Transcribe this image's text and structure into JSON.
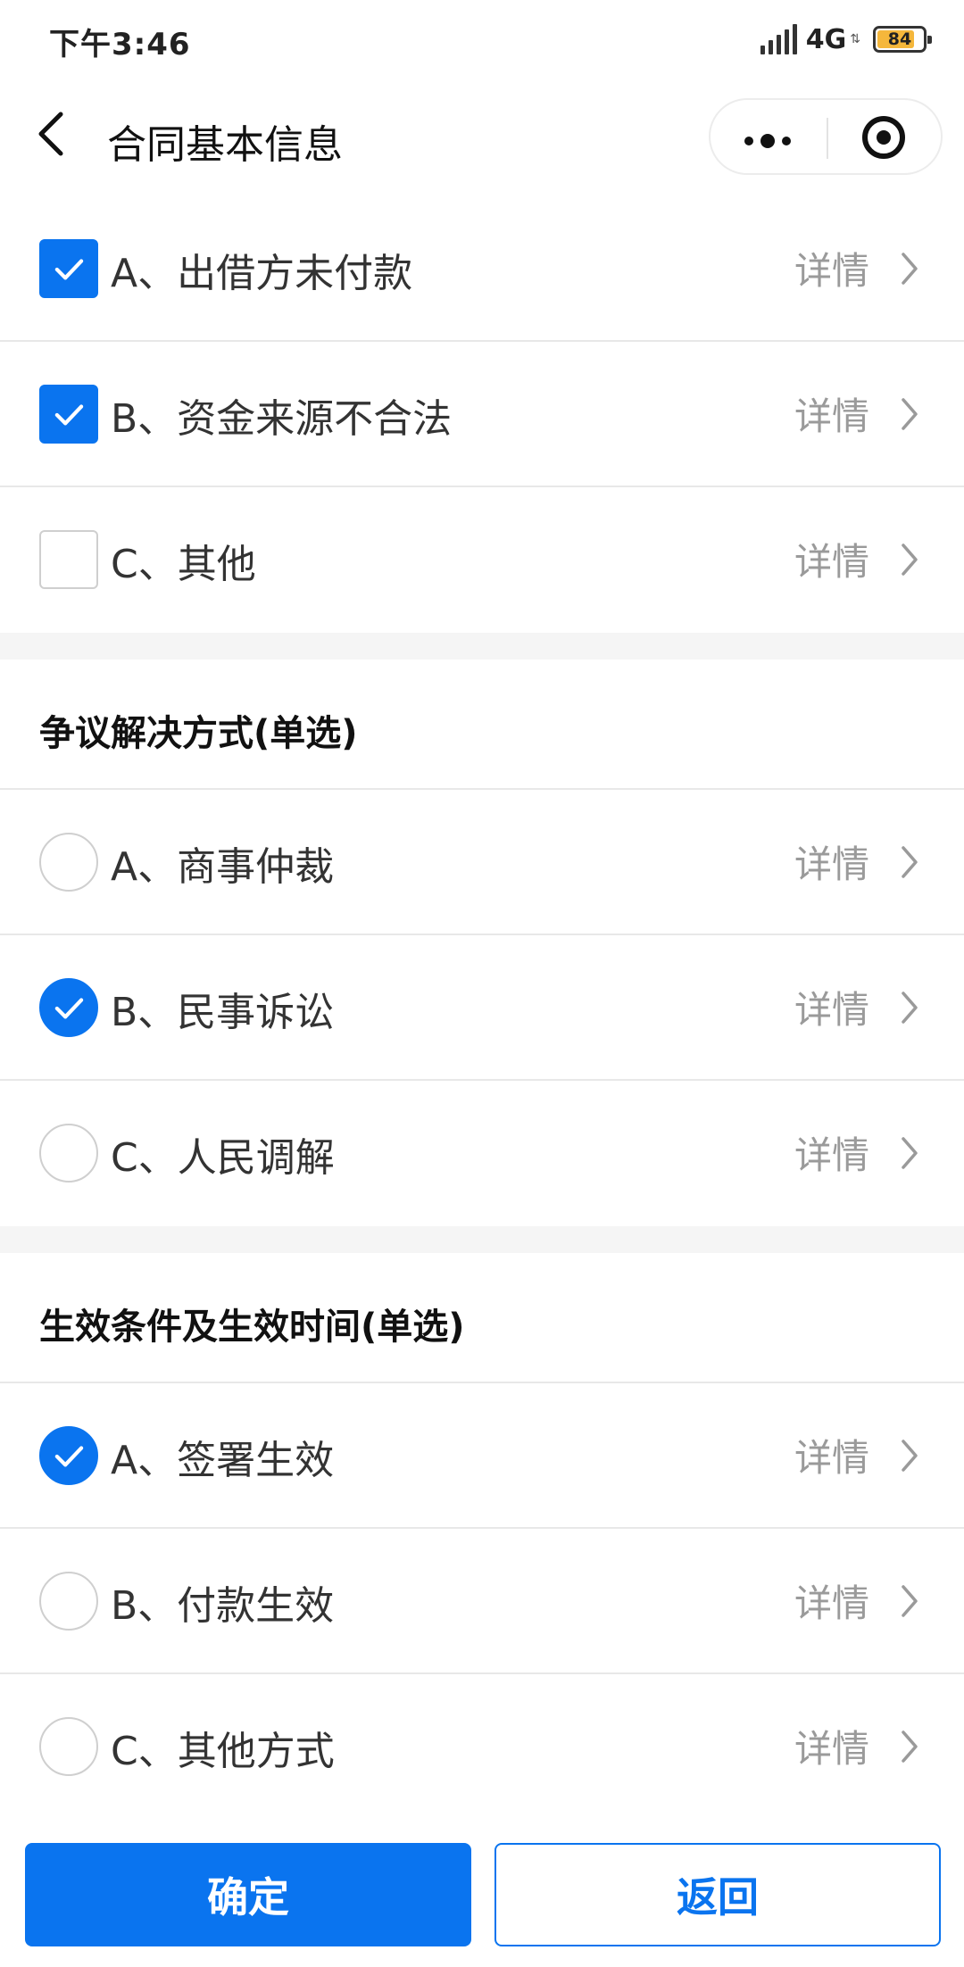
{
  "status_bar": {
    "time": "下午3:46",
    "network": "4G",
    "battery": "84",
    "battery_level": 0.84
  },
  "nav": {
    "title": "合同基本信息",
    "icons": [
      "back-icon",
      "more-icon",
      "target-icon"
    ]
  },
  "colors": {
    "accent": "#0a74ef",
    "detail_gray": "#9a9a9a"
  },
  "group_top": {
    "options": [
      {
        "label": "A、出借方未付款",
        "detail": "详情",
        "checked": true
      },
      {
        "label": "B、资金来源不合法",
        "detail": "详情",
        "checked": true
      },
      {
        "label": "C、其他",
        "detail": "详情",
        "checked": false
      }
    ]
  },
  "dispute": {
    "title": "争议解决方式(单选)",
    "options": [
      {
        "label": "A、商事仲裁",
        "detail": "详情",
        "checked": false
      },
      {
        "label": "B、民事诉讼",
        "detail": "详情",
        "checked": true
      },
      {
        "label": "C、人民调解",
        "detail": "详情",
        "checked": false
      }
    ]
  },
  "effect": {
    "title": "生效条件及生效时间(单选)",
    "options": [
      {
        "label": "A、签署生效",
        "detail": "详情",
        "checked": true
      },
      {
        "label": "B、付款生效",
        "detail": "详情",
        "checked": false
      },
      {
        "label": "C、其他方式",
        "detail": "详情",
        "checked": false
      }
    ]
  },
  "footer": {
    "confirm": "确定",
    "back": "返回"
  }
}
